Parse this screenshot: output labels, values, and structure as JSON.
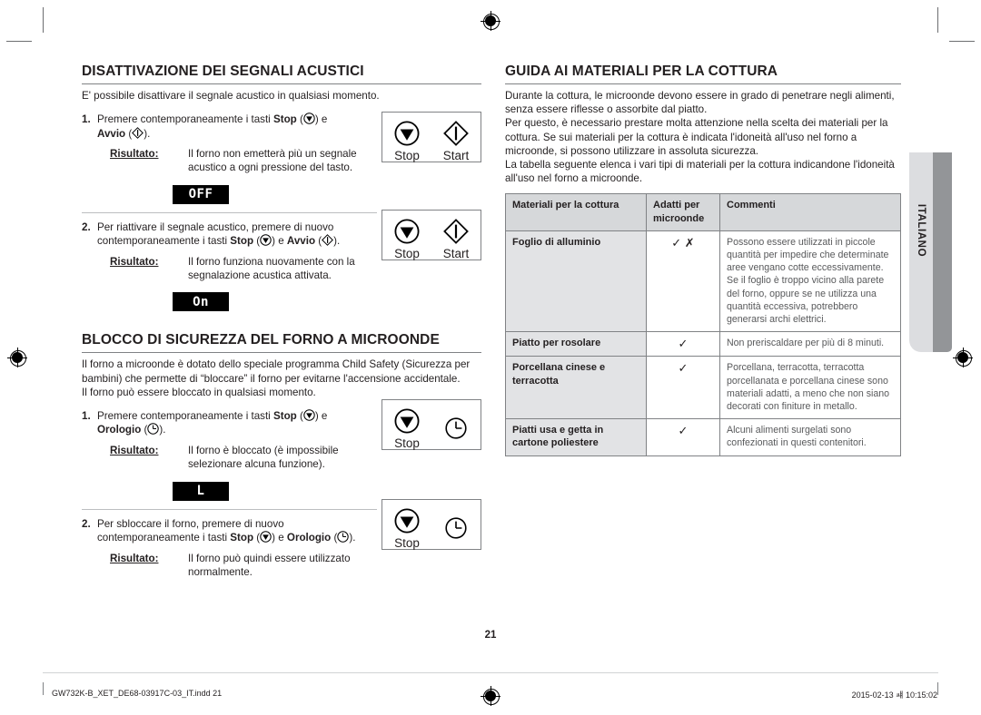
{
  "page": {
    "number": "21",
    "language_tab": "ITALIANO"
  },
  "left": {
    "section1": {
      "heading": "DISATTIVAZIONE DEI SEGNALI ACUSTICI",
      "intro": "E' possibile disattivare il segnale acustico in qualsiasi momento.",
      "step1": {
        "num": "1.",
        "text_a": "Premere contemporaneamente i tasti ",
        "bold_a": "Stop",
        "text_b": " (",
        "text_c": ") e",
        "bold_b": "Avvio",
        "text_d": " (",
        "text_e": ").",
        "result_label": "Risultato:",
        "result_text": "Il forno non emetterà più un segnale acustico a ogni pressione del tasto.",
        "led": "OFF"
      },
      "step2": {
        "num": "2.",
        "text_a": "Per riattivare il segnale acustico, premere di nuovo contemporaneamente i tasti ",
        "bold_a": "Stop",
        "text_b": " (",
        "text_c": ") e ",
        "bold_b": "Avvio",
        "text_d": " (",
        "text_e": ").",
        "result_label": "Risultato:",
        "result_text": "Il forno funziona nuovamente con la segnalazione acustica attivata.",
        "led": "On"
      },
      "keybox1": {
        "stop": "Stop",
        "start": "Start"
      },
      "keybox2": {
        "stop": "Stop",
        "start": "Start"
      }
    },
    "section2": {
      "heading": "BLOCCO DI SICUREZZA DEL FORNO A MICROONDE",
      "intro_p1": "Il forno a microonde è dotato dello speciale programma Child Safety (Sicurezza per bambini) che permette di “bloccare” il forno per evitarne l'accensione accidentale.",
      "intro_p2": "Il forno può essere bloccato in qualsiasi momento.",
      "step1": {
        "num": "1.",
        "text_a": "Premere contemporaneamente i tasti ",
        "bold_a": "Stop",
        "text_b": " (",
        "text_c": ") e",
        "bold_b": "Orologio",
        "text_d": " (",
        "text_e": ").",
        "result_label": "Risultato:",
        "result_text": "Il forno è bloccato (è impossibile selezionare alcuna funzione).",
        "led": "L"
      },
      "step2": {
        "num": "2.",
        "text_a": "Per sbloccare il forno, premere di nuovo contemporaneamente i tasti ",
        "bold_a": "Stop",
        "text_b": " (",
        "text_c": ") e ",
        "bold_b": "Orologio",
        "text_d": " (",
        "text_e": ").",
        "result_label": "Risultato:",
        "result_text": "Il forno può quindi essere utilizzato normalmente.",
        "led": ""
      },
      "keybox1": {
        "stop": "Stop"
      },
      "keybox2": {
        "stop": "Stop"
      }
    }
  },
  "right": {
    "heading": "GUIDA AI MATERIALI PER LA COTTURA",
    "intro_p1": "Durante la cottura, le microonde devono essere in grado di penetrare negli alimenti, senza essere riflesse o assorbite dal piatto.",
    "intro_p2": "Per questo, è necessario prestare molta attenzione nella scelta dei materiali per la cottura. Se sui materiali per la cottura è indicata l'idoneità all'uso nel forno a microonde, si possono utilizzare in assoluta sicurezza.",
    "intro_p3": "La tabella seguente elenca i vari tipi di materiali per la cottura indicandone l'idoneità all'uso nel forno a microonde.",
    "table": {
      "headers": [
        "Materiali per la cottura",
        "Adatti per microonde",
        "Commenti"
      ],
      "rows": [
        {
          "material": "Foglio di alluminio",
          "suitable": "✓ ✗",
          "comment": "Possono essere utilizzati in piccole quantità per impedire che determinate aree vengano cotte eccessivamente. Se il foglio è troppo vicino alla parete del forno, oppure se ne utilizza una quantità eccessiva, potrebbero generarsi archi elettrici."
        },
        {
          "material": "Piatto per rosolare",
          "suitable": "✓",
          "comment": "Non preriscaldare per più di 8 minuti."
        },
        {
          "material": "Porcellana cinese e terracotta",
          "suitable": "✓",
          "comment": "Porcellana, terracotta, terracotta porcellanata e porcellana cinese sono materiali adatti, a meno che non siano decorati con finiture in metallo."
        },
        {
          "material": "Piatti usa e getta in cartone poliestere",
          "suitable": "✓",
          "comment": "Alcuni alimenti surgelati sono confezionati in questi contenitori."
        }
      ]
    }
  },
  "footer": {
    "filename": "GW732K-B_XET_DE68-03917C-03_IT.indd   21",
    "timestamp": "2015-02-13   ㆈ 10:15:02"
  }
}
